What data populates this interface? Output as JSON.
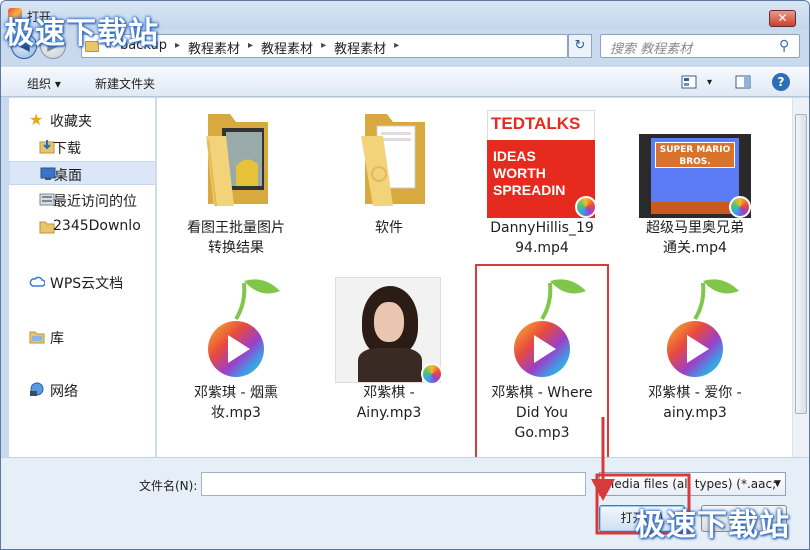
{
  "window": {
    "title": "打开",
    "close_symbol": "✕"
  },
  "watermark": "极速下载站",
  "nav": {
    "back_symbol": "◀",
    "forward_symbol": "▶",
    "crumbs": [
      "«",
      "backup",
      "教程素材",
      "教程素材",
      "教程素材"
    ],
    "search_placeholder": "搜索 教程素材"
  },
  "toolbar": {
    "organize": "组织 ▾",
    "new_folder": "新建文件夹",
    "view_drop": "▾",
    "help": "?"
  },
  "sidebar": {
    "favorites": "收藏夹",
    "items": [
      "下载",
      "桌面",
      "最近访问的位",
      "2345Downlo"
    ],
    "wps": "WPS云文档",
    "library": "库",
    "network": "网络"
  },
  "files": [
    {
      "name": "看图王批量图片\n转换结果",
      "kind": "folder-photos"
    },
    {
      "name": "软件",
      "kind": "folder-docs"
    },
    {
      "name": "DannyHillis_19\n94.mp4",
      "kind": "ted"
    },
    {
      "name": "超级马里奥兄弟\n通关.mp4",
      "kind": "mario"
    },
    {
      "name": "邓紫琪 - 烟熏\n妆.mp3",
      "kind": "cherry"
    },
    {
      "name": "邓紫棋 -\nAiny.mp3",
      "kind": "photo"
    },
    {
      "name": "邓紫棋 - Where\nDid You\nGo.mp3",
      "kind": "cherry",
      "selected": true
    },
    {
      "name": "邓紫棋 - 爱你 -\nainy.mp3",
      "kind": "cherry"
    }
  ],
  "ted": {
    "brand": "TEDTALKS",
    "lines": [
      "IDEAS",
      "WORTH",
      "SPREADIN"
    ]
  },
  "mario": {
    "title": "SUPER MARIO BROS."
  },
  "bottom": {
    "filename_label": "文件名(N):",
    "filename_value": "",
    "filetype_value": "Media files (all types) (*.aac;",
    "open_label": "打开(O)",
    "cancel_label": ""
  },
  "colors": {
    "highlight": "#d63a3a",
    "accent": "#3c7fb1"
  }
}
